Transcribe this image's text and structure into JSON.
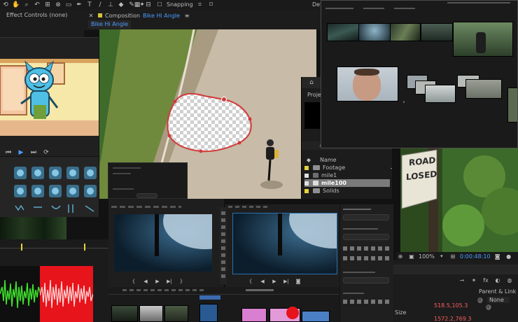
{
  "toolbar": {
    "snapping_label": "Snapping",
    "workspace_label": "Defa"
  },
  "effect_controls": {
    "title": "Effect Controls (none)"
  },
  "composition": {
    "title_prefix": "Composition",
    "comp_name": "Bike Hi Angle",
    "tab_label": "Bike Hi Angle"
  },
  "project": {
    "title": "Project",
    "header_name": "Name",
    "items": [
      {
        "label": "Footage",
        "type": "folder"
      },
      {
        "label": "mile1",
        "type": "file"
      },
      {
        "label": "mile100",
        "type": "file",
        "selected": true
      },
      {
        "label": "Solids",
        "type": "folder"
      }
    ]
  },
  "viewer_right": {
    "zoom": "100%",
    "timecode": "0:00:48:10"
  },
  "sign": {
    "line1": "ROAD",
    "line2": "LOSED"
  },
  "properties": {
    "parent_link_label": "Parent & Link",
    "parent_value": "None",
    "size_label": "Size",
    "value1": "518.5,105.3",
    "value2": "1572.2,769.3"
  },
  "colors": {
    "accent_blue": "#4b9cff",
    "mask_red": "#d23a3a",
    "audio_green": "#3ee02c",
    "audio_red_bg": "#e8141c",
    "value_red": "#ff5c5c"
  }
}
